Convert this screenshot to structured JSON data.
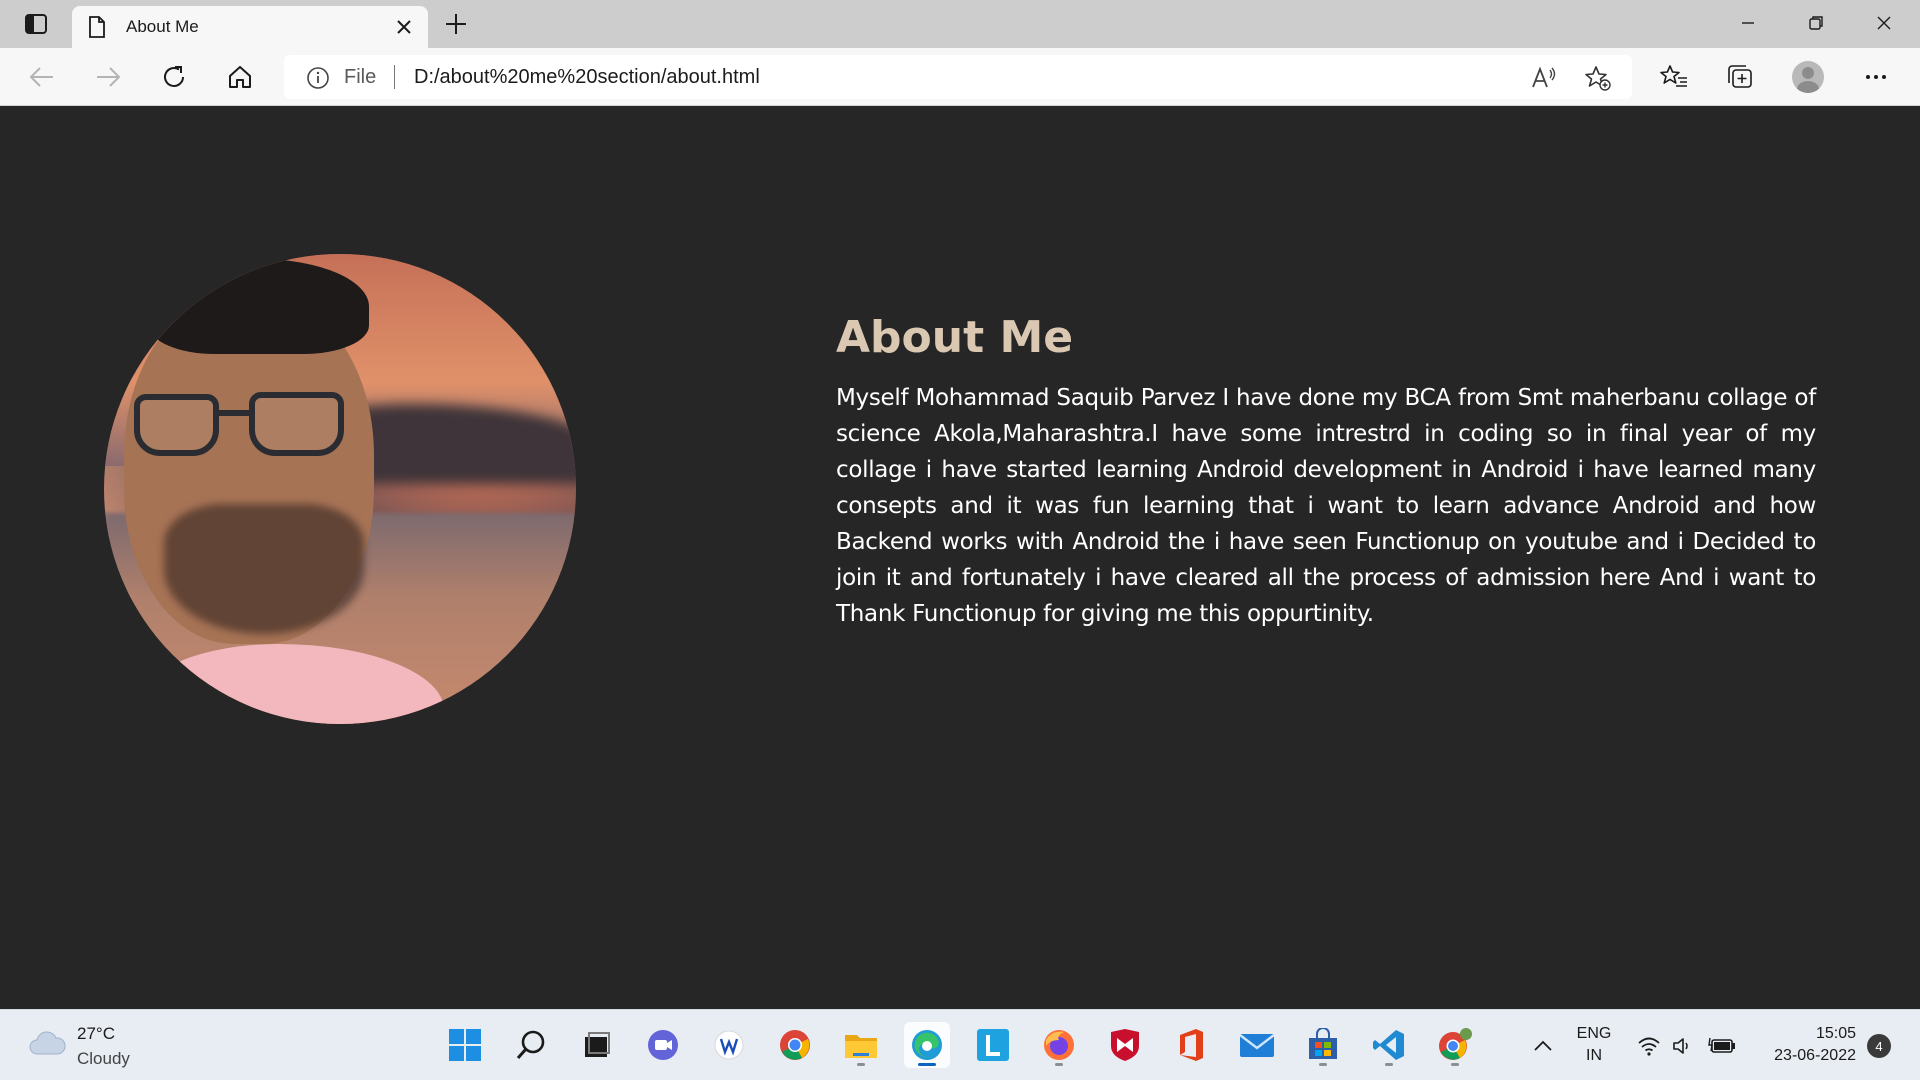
{
  "browser": {
    "tab": {
      "title": "About Me",
      "icon": "page-icon"
    },
    "address": {
      "scheme": "File",
      "url": "D:/about%20me%20section/about.html"
    },
    "icons": [
      "tab-actions-icon",
      "close-icon",
      "plus-icon",
      "minimize-icon",
      "restore-icon",
      "window-close-icon",
      "back-icon",
      "forward-icon",
      "refresh-icon",
      "home-icon",
      "info-icon",
      "read-aloud-icon",
      "add-favorite-icon",
      "favorites-icon",
      "collections-icon",
      "profile-icon",
      "more-icon"
    ]
  },
  "page": {
    "title": "About Me",
    "paragraph": "Myself Mohammad Saquib Parvez I have done my BCA from Smt maherbanu collage of science Akola,Maharashtra.I have some intrestrd in coding so in final year of my collage i have started learning Android development in Android i have learned many consepts and it was fun learning that i want to learn advance Android and how Backend works with Android the i have seen Functionup on youtube and i Decided to join it and fortunately i have cleared all the process of admission here And i want to Thank Functionup for giving me this oppurtinity.",
    "background_color": "#262626",
    "title_color": "#dbc8b2",
    "text_color": "#ffffff"
  },
  "taskbar": {
    "weather": {
      "temp": "27°C",
      "condition": "Cloudy"
    },
    "apps": [
      "windows-start-icon",
      "search-icon",
      "task-view-icon",
      "teams-chat-icon",
      "writer-app-icon",
      "chrome-icon",
      "file-explorer-icon",
      "edge-icon",
      "l-app-icon",
      "firefox-icon",
      "mcafee-icon",
      "office-icon",
      "mail-icon",
      "store-icon",
      "vscode-icon",
      "chrome-profile-icon"
    ],
    "language": {
      "line1": "ENG",
      "line2": "IN"
    },
    "clock": {
      "time": "15:05",
      "date": "23-06-2022"
    },
    "notification_count": "4"
  }
}
